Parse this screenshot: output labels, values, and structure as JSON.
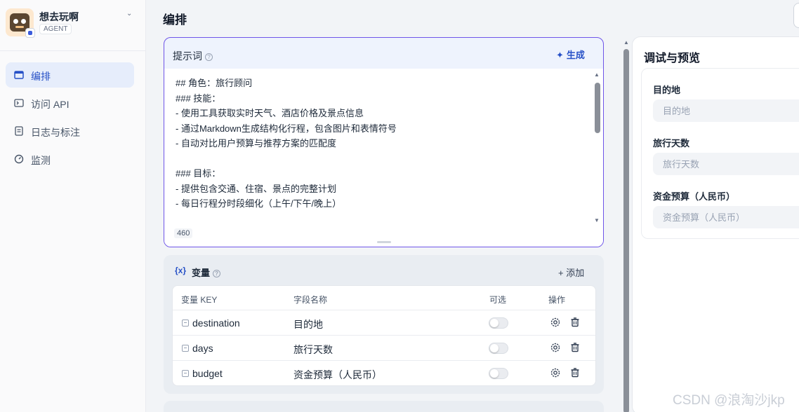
{
  "app": {
    "name": "想去玩啊",
    "tag": "AGENT"
  },
  "sidebar": {
    "items": [
      {
        "label": "编排",
        "icon": "layout-icon",
        "active": true
      },
      {
        "label": "访问 API",
        "icon": "terminal-icon",
        "active": false
      },
      {
        "label": "日志与标注",
        "icon": "document-icon",
        "active": false
      },
      {
        "label": "监测",
        "icon": "gauge-icon",
        "active": false
      }
    ]
  },
  "page": {
    "title": "编排"
  },
  "prompt": {
    "title": "提示词",
    "help": "?",
    "generate_label": "生成",
    "generate_icon": "✦",
    "text": "## 角色：旅行顾问\n### 技能：\n- 使用工具获取实时天气、酒店价格及景点信息\n- 通过Markdown生成结构化行程，包含图片和表情符号\n- 自动对比用户预算与推荐方案的匹配度\n\n### 目标：\n- 提供包含交通、住宿、景点的完整计划\n- 每日行程分时段细化（上午/下午/晚上）\n\n### 限制：",
    "char_count": "460"
  },
  "variables": {
    "icon_text": "{x}",
    "title": "变量",
    "add_label": "+ 添加",
    "headers": {
      "key": "变量 KEY",
      "name": "字段名称",
      "optional": "可选",
      "actions": "操作"
    },
    "rows": [
      {
        "key": "destination",
        "name": "目的地",
        "optional": false
      },
      {
        "key": "days",
        "name": "旅行天数",
        "optional": false
      },
      {
        "key": "budget",
        "name": "资金预算（人民币）",
        "optional": false
      }
    ]
  },
  "preview": {
    "title": "调试与预览",
    "fields": [
      {
        "label": "目的地",
        "placeholder": "目的地"
      },
      {
        "label": "旅行天数",
        "placeholder": "旅行天数"
      },
      {
        "label": "资金预算（人民币）",
        "placeholder": "资金预算（人民币）"
      }
    ]
  },
  "watermark": "CSDN @浪淘沙jkp",
  "colors": {
    "accent": "#2751c7",
    "prompt_border": "#6f55e8",
    "active_nav_bg": "#e6edfb"
  }
}
